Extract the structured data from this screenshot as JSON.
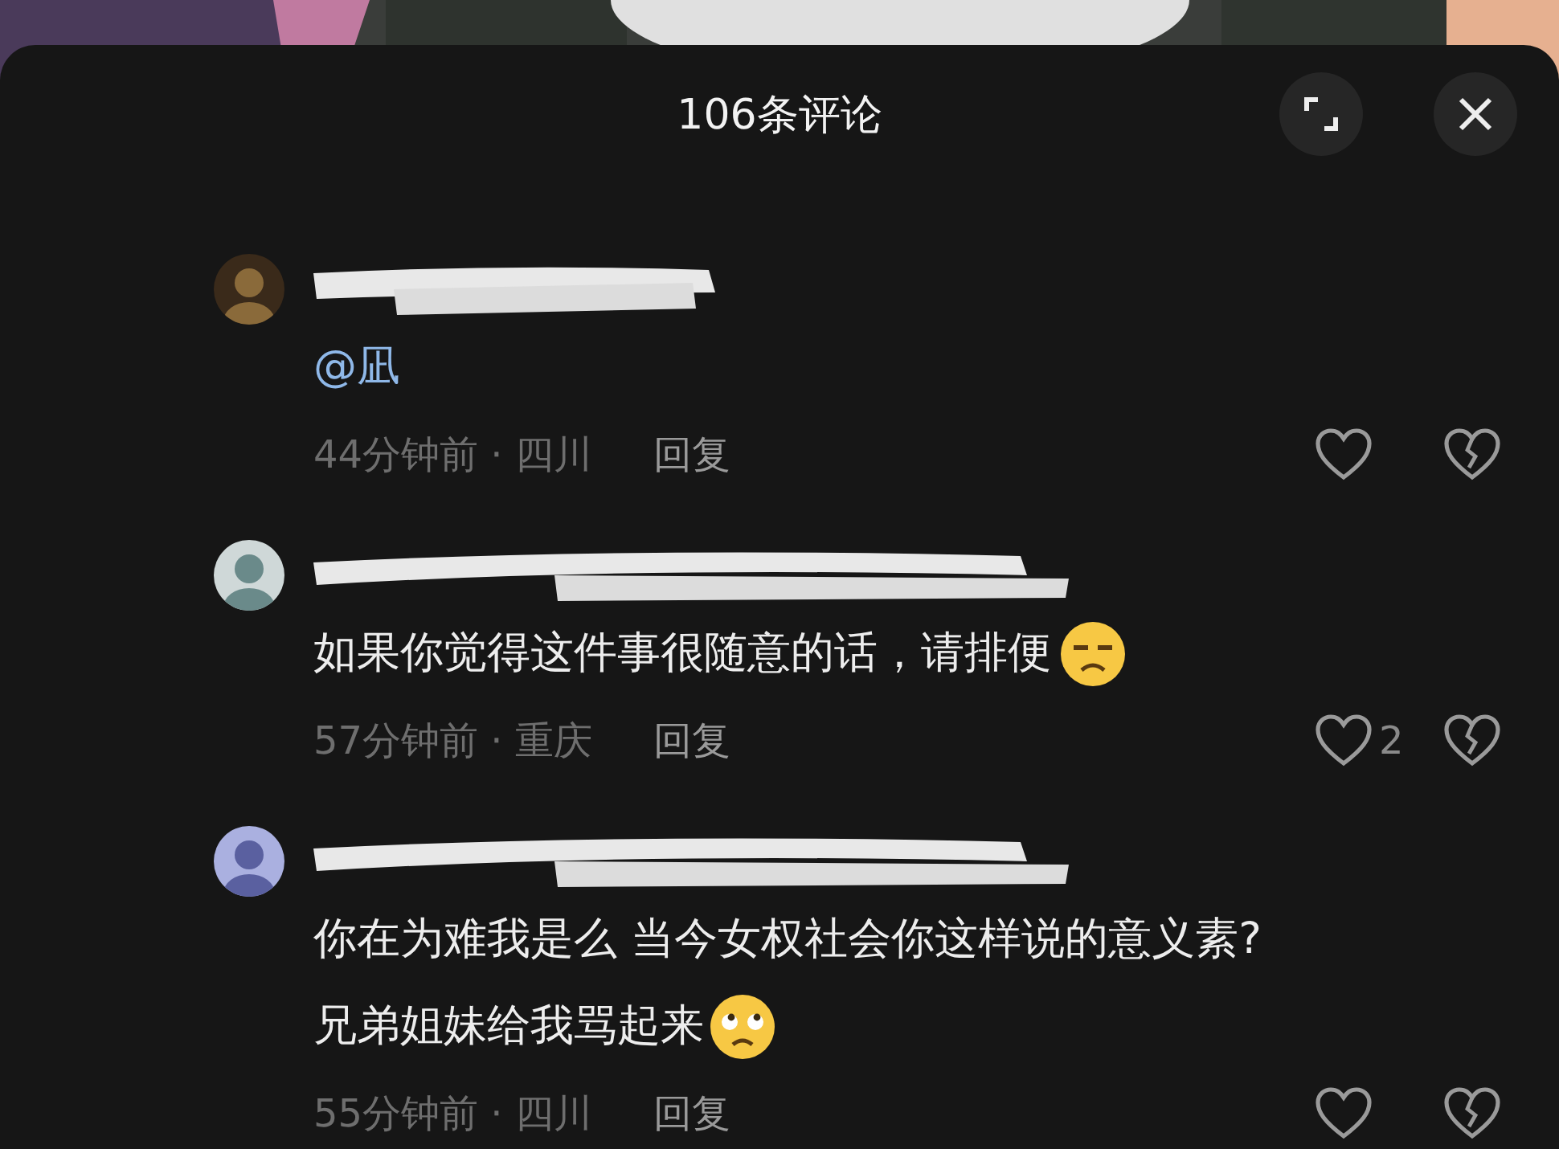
{
  "header": {
    "title": "106条评论"
  },
  "comments": [
    {
      "lines": [
        {
          "text": "@凪",
          "kind": "mention"
        }
      ],
      "meta": "44分钟前 · 四川",
      "reply": "回复"
    },
    {
      "lines": [
        {
          "text": "如果你觉得这件事很随意的话，请排便",
          "kind": "plain"
        }
      ],
      "emoji": {
        "kind": "unamused"
      },
      "meta": "57分钟前 · 重庆",
      "reply": "回复",
      "likes": "2"
    },
    {
      "lines": [
        {
          "text": "你在为难我是么 当今女权社会你这样说的意义素?",
          "kind": "plain"
        },
        {
          "text": "兄弟姐妹给我骂起来",
          "kind": "plain"
        }
      ],
      "emoji": {
        "kind": "eyeroll"
      },
      "meta": "55分钟前 · 四川",
      "reply": "回复"
    }
  ]
}
